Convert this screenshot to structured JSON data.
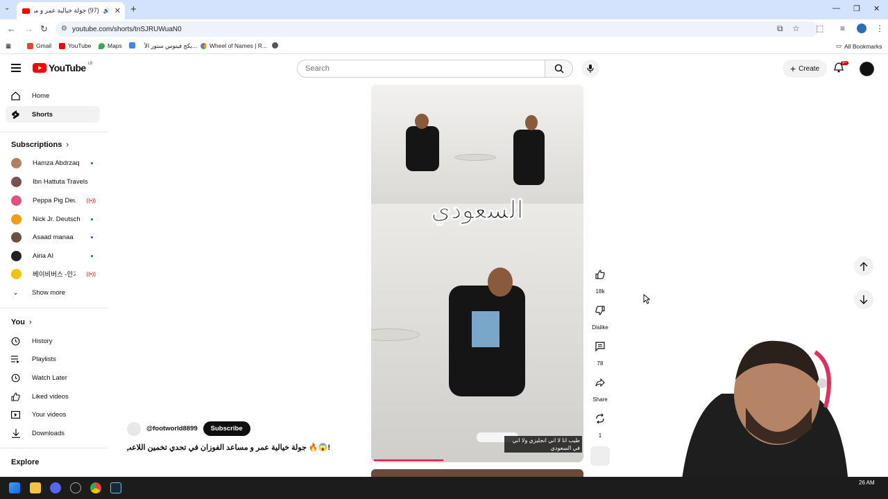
{
  "browser": {
    "tab_title": "(97) جولة خيالية عمر و مساعد",
    "new_tab": "+",
    "url": "youtube.com/shorts/tnSJRUWuaN0",
    "bookmarks": [
      {
        "label": "Gmail",
        "color": "#ea4335"
      },
      {
        "label": "YouTube",
        "color": "#ff0000"
      },
      {
        "label": "Maps",
        "color": "#34a853"
      },
      {
        "label": "",
        "color": "#4285f4"
      },
      {
        "label": "بكج فيتوس ستور الأ...",
        "color": "#ffffff"
      },
      {
        "label": "Wheel of Names | R...",
        "color": "#fbbc04"
      },
      {
        "label": "",
        "color": "#555555"
      }
    ],
    "all_bookmarks": "All Bookmarks"
  },
  "header": {
    "logo": "YouTube",
    "logo_country": "LB",
    "search_placeholder": "Search",
    "create_label": "Create",
    "notif_count": "9+"
  },
  "sidebar": {
    "main": [
      {
        "label": "Home",
        "icon": "home-icon"
      },
      {
        "label": "Shorts",
        "icon": "shorts-icon"
      }
    ],
    "subscriptions_title": "Subscriptions",
    "subscriptions": [
      {
        "label": "Hamza Abdrzaq",
        "color": "#b08060",
        "status": "new"
      },
      {
        "label": "Ibn Hattuta Travels",
        "color": "#7a5050",
        "status": ""
      },
      {
        "label": "Peppa Pig Deutsch...",
        "color": "#e05080",
        "status": "live"
      },
      {
        "label": "Nick Jr. Deutschl...",
        "color": "#f39c12",
        "status": "new"
      },
      {
        "label": "Asaad manaa",
        "color": "#6b5040",
        "status": "new"
      },
      {
        "label": "Airia AI",
        "color": "#222222",
        "status": "new"
      },
      {
        "label": "베이비버스 -인기...",
        "color": "#f1c40f",
        "status": "live"
      }
    ],
    "show_more": "Show more",
    "you_title": "You",
    "you": [
      {
        "label": "History",
        "icon": "history-icon"
      },
      {
        "label": "Playlists",
        "icon": "playlists-icon"
      },
      {
        "label": "Watch Later",
        "icon": "watch-later-icon"
      },
      {
        "label": "Liked videos",
        "icon": "like-icon"
      },
      {
        "label": "Your videos",
        "icon": "your-videos-icon"
      },
      {
        "label": "Downloads",
        "icon": "download-icon"
      }
    ],
    "explore_title": "Explore"
  },
  "short": {
    "caption": "السعودي",
    "subtitle": "طيب انا لا اني انجليزي ولا اني في السعودي",
    "progress": 0.33,
    "channel": "@footworld8899",
    "subscribe": "Subscribe",
    "title": "!😱🔥 جولة خيالية عمر و مساعد الفوزان في تحدي تخمين اللاعب",
    "likes": "18k",
    "dislike": "Dislike",
    "comments": "78",
    "share": "Share",
    "remix": "1"
  },
  "taskbar": {
    "clock": "26 AM"
  },
  "colors": {
    "accent": "#ff0000",
    "subscribe_bg": "#0f0f0f"
  }
}
